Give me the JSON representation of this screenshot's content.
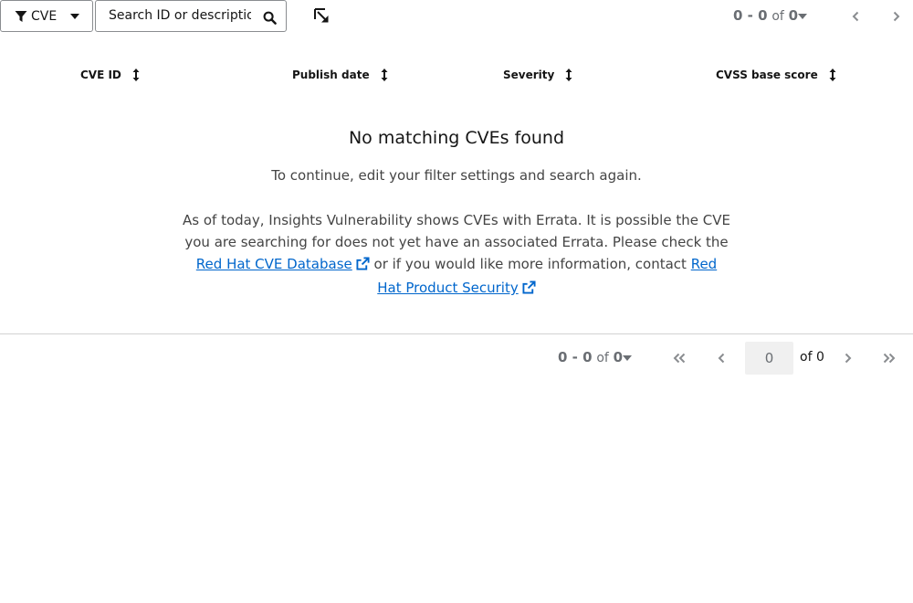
{
  "toolbar": {
    "filter_label": "CVE",
    "search_placeholder": "Search ID or description",
    "top_pagination": {
      "range": "0 - 0",
      "of": "of",
      "total": "0"
    }
  },
  "table": {
    "columns": [
      "CVE ID",
      "Publish date",
      "Severity",
      "CVSS base score"
    ]
  },
  "empty_state": {
    "title": "No matching CVEs found",
    "subtitle": "To continue, edit your filter settings and search again.",
    "body_prefix": "As of today, Insights Vulnerability shows CVEs with Errata. It is possible the CVE you are searching for does not yet have an associated Errata. Please check the ",
    "link_db": "Red Hat CVE Database",
    "body_middle": " or if you would like more information, contact ",
    "link_security": "Red Hat Product Security"
  },
  "bottom_pagination": {
    "range": "0 - 0",
    "of": "of",
    "total": "0",
    "page_value": "0",
    "of_pages": "of 0"
  },
  "colors": {
    "link": "#0066cc",
    "text": "#151515",
    "muted": "#6a6e73",
    "divider": "#d2d2d2"
  }
}
